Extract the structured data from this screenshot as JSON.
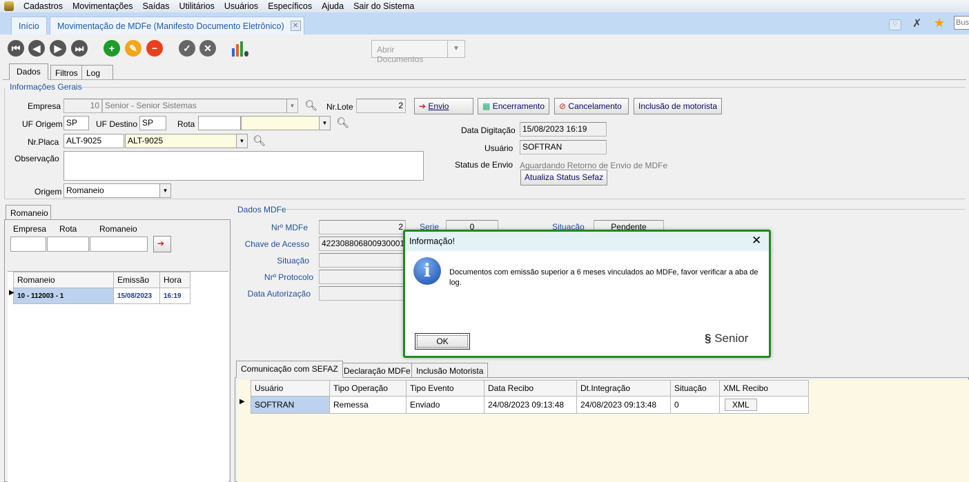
{
  "menu": [
    "Cadastros",
    "Movimentações",
    "Saídas",
    "Utilitários",
    "Usuários",
    "Específicos",
    "Ajuda",
    "Sair do Sistema"
  ],
  "tabs": {
    "home": "Início",
    "active": "Movimentação de MDFe (Manifesto Documento Eletrônico)"
  },
  "search_placeholder": "Bus",
  "toolbar": {
    "open_docs": "Abrir Documentos"
  },
  "subtabs": [
    "Dados",
    "Filtros",
    "Log"
  ],
  "geral": {
    "title": "Informações Gerais",
    "empresa_label": "Empresa",
    "empresa_code": "10",
    "empresa_name": "Senior - Senior Sistemas",
    "nrlote_label": "Nr.Lote",
    "nrlote": "2",
    "uf_origem_label": "UF Origem",
    "uf_origem": "SP",
    "uf_destino_label": "UF Destino",
    "uf_destino": "SP",
    "rota_label": "Rota",
    "placa_label": "Nr.Placa",
    "placa": "ALT-9025",
    "placa_combo": "ALT-9025",
    "obs_label": "Observação",
    "origem_label": "Origem",
    "origem": "Romaneio",
    "data_dig_label": "Data Digitação",
    "data_dig": "15/08/2023 16:19",
    "usuario_label": "Usuário",
    "usuario": "SOFTRAN",
    "status_label": "Status de Envio",
    "status": "Aguardando Retorno de Envio de MDFe"
  },
  "buttons": {
    "envio": "Envio",
    "encerramento": "Encerramento",
    "cancelamento": "Cancelamento",
    "inclusao": "Inclusão de motorista",
    "atualiza": "Atualiza Status Sefaz"
  },
  "romaneio": {
    "tab": "Romaneio",
    "empresa": "Empresa",
    "rota": "Rota",
    "romaneio": "Romaneio",
    "headers": [
      "Romaneio",
      "Emissão",
      "Hora"
    ],
    "rows": [
      [
        "10 - 112003 - 1",
        "15/08/2023",
        "16:19"
      ]
    ]
  },
  "mdfe": {
    "title": "Dados MDFe",
    "nr_label": "Nrº MDFe",
    "nr": "2",
    "serie_label": "Serie",
    "serie": "0",
    "situacao_label": "Situação",
    "situacao": "Pendente",
    "chave_label": "Chave de Acesso",
    "chave": "42230880680093000188",
    "sit_label": "Situação",
    "protocolo_label": "Nrº Protocolo",
    "autorizacao_label": "Data Autorização"
  },
  "bottom_tabs": [
    "Comunicação com SEFAZ",
    "Declaração MDFe",
    "Inclusão Motorista"
  ],
  "sefaz": {
    "headers": [
      "Usuário",
      "Tipo Operação",
      "Tipo Evento",
      "Data Recibo",
      "Dt.Integração",
      "Situação",
      "XML Recibo"
    ],
    "rows": [
      [
        "SOFTRAN",
        "Remessa",
        "Enviado",
        "24/08/2023 09:13:48",
        "24/08/2023 09:13:48",
        "0",
        "XML"
      ]
    ]
  },
  "dialog": {
    "title": "Informação!",
    "message": "Documentos com emissão superior a 6 meses vinculados ao MDFe, favor verificar a aba de log.",
    "ok": "OK",
    "brand": "Senior"
  }
}
